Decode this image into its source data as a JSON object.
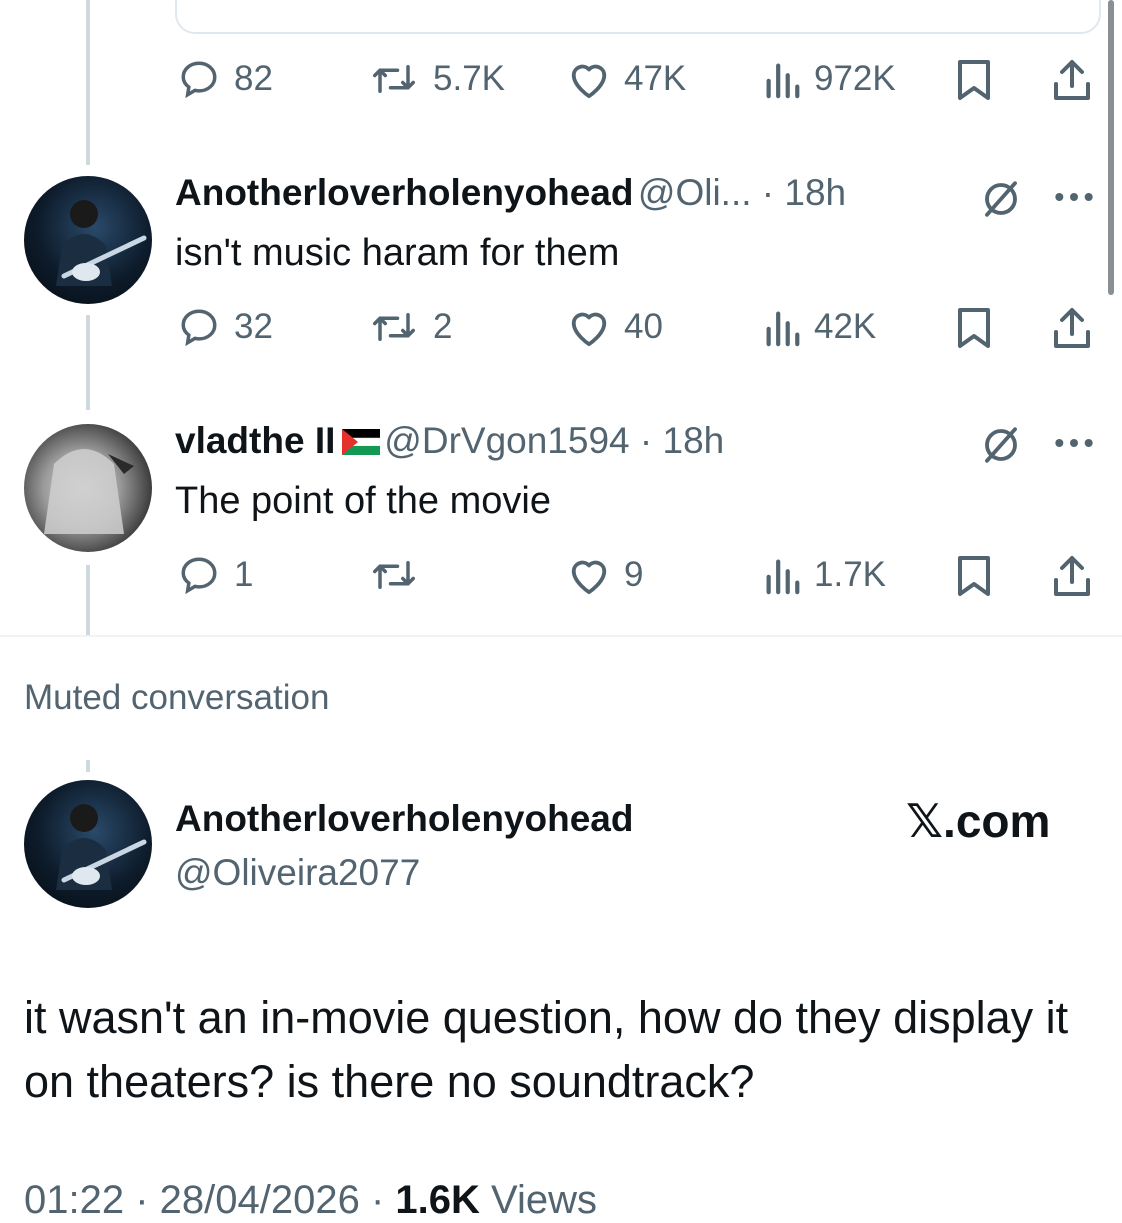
{
  "colors": {
    "text": "#0f1419",
    "muted": "#536471",
    "line": "#cfd9de"
  },
  "top_tweet": {
    "actions": {
      "replies": "82",
      "reposts": "5.7K",
      "likes": "47K",
      "views": "972K"
    }
  },
  "reply1": {
    "display_name": "Anotherloverholenyohead",
    "handle_time": "@Oli... · 18h",
    "text": "isn't music haram for them",
    "actions": {
      "replies": "32",
      "reposts": "2",
      "likes": "40",
      "views": "42K"
    }
  },
  "reply2": {
    "display_name": "vladthe II",
    "handle_time": "@DrVgon1594 · 18h",
    "text": "The point of the movie",
    "actions": {
      "replies": "1",
      "reposts": "",
      "likes": "9",
      "views": "1.7K"
    }
  },
  "muted_label": "Muted conversation",
  "main_tweet": {
    "display_name": "Anotherloverholenyohead",
    "handle": "@Oliveira2077",
    "brand": "𝕏.com",
    "text": "it wasn't an in-movie question, how do they display it on theaters? is there no soundtrack?",
    "footer_time": "01:22 · 28/04/2026 · ",
    "footer_views_count": "1.6K",
    "footer_views_label": " Views"
  }
}
